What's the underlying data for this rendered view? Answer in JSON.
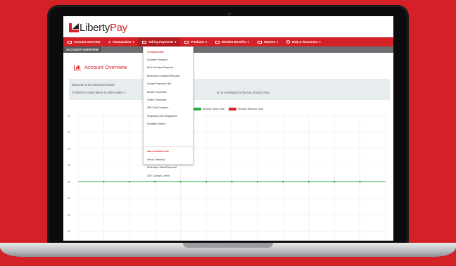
{
  "brand": {
    "name_prefix": "Liberty",
    "name_suffix": "Pay"
  },
  "nav": {
    "items": [
      {
        "label": "Account Overview",
        "icon": "chart-icon",
        "active": true
      },
      {
        "label": "Transactions",
        "icon": "pound-icon",
        "caret": "▾"
      },
      {
        "label": "Taking Payments",
        "icon": "card-icon",
        "caret": "▾"
      },
      {
        "label": "Products",
        "icon": "products-icon",
        "caret": "▾"
      },
      {
        "label": "Member Benefits",
        "icon": "building-icon",
        "caret": "▾"
      },
      {
        "label": "Reports",
        "icon": "table-icon",
        "caret": "▾"
      },
      {
        "label": "Help & Resources",
        "icon": "question-icon",
        "caret": "▾"
      }
    ]
  },
  "subnav": {
    "active_label": "ACCOUNT OVERVIEW"
  },
  "page": {
    "title": "Account Overview"
  },
  "welcome": {
    "line1": "Welcome to the Merchant Portal.",
    "line2_start": "To limit the charts below to either Sales o",
    "line2_end": "en or red legend at the top of each chart."
  },
  "dropdown": {
    "section1": "AUTHENTICATED",
    "items1": [
      "Donation Request",
      "Bulk Donation Request",
      "Multi-User Donation Request",
      "Invoice Payment Link",
      "Mobile Payments",
      "Online Payments",
      "QR Code Donation",
      "Shopping Cart Integrations",
      "Donation Button"
    ],
    "section2": "NON-AUTHENTICATED",
    "items2": [
      "Virtual Terminal",
      "Multi-User Virtual Terminal",
      "24/7 Contact Centre"
    ]
  },
  "legend": {
    "sales": "Monthly Sales Total",
    "refunds": "Monthly Refunds Total"
  },
  "colors": {
    "brand": "#d42027",
    "sales": "#2eaa3f",
    "refunds": "#d42027"
  },
  "chart_data": {
    "type": "line",
    "y_tick_labels": [
      "£1",
      "£1",
      "£1",
      "£0",
      "£0",
      "£0",
      "£0",
      "£0",
      "-£1"
    ],
    "series": [
      {
        "name": "Monthly Sales Total",
        "values": [
          0,
          0,
          0,
          0,
          0,
          0,
          0,
          0,
          0,
          0,
          0,
          0,
          0
        ]
      }
    ],
    "grid": true
  }
}
